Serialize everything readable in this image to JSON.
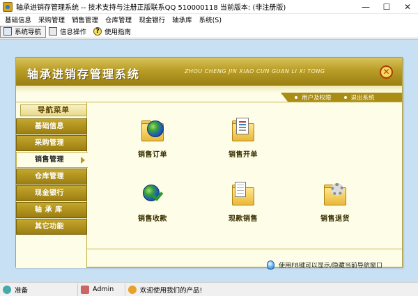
{
  "window": {
    "title": "轴承进销存管理系统 -- 技术支持与注册正版联系QQ 510000118    当前版本: (非注册版)",
    "minimize_symbol": "—",
    "maximize_symbol": "☐",
    "close_symbol": "✕"
  },
  "menu": {
    "items": [
      "基础信息",
      "采购管理",
      "销售管理",
      "仓库管理",
      "现金银行",
      "轴承库",
      "系统(S)"
    ]
  },
  "toolbar": {
    "items": [
      {
        "label": "系统导航",
        "icon": "monitor-icon",
        "active": true
      },
      {
        "label": "信息操作",
        "icon": "window-icon",
        "active": false
      },
      {
        "label": "使用指南",
        "icon": "help-icon",
        "active": false
      }
    ],
    "help_glyph": "?"
  },
  "panel": {
    "title": "轴承进销存管理系统",
    "subtitle": "ZHOU CHENG JIN XIAO CUN GUAN LI XI TONG",
    "close_glyph": "✕",
    "user_links": [
      "用户及权限",
      "退出系统"
    ]
  },
  "nav": {
    "header": "导航菜单",
    "items": [
      "基础信息",
      "采购管理",
      "销售管理",
      "仓库管理",
      "现金银行",
      "轴 承 库",
      "其它功能"
    ],
    "active_index": 2
  },
  "content": {
    "tiles": [
      {
        "label": "销售订单",
        "icon": "folder-globe-icon"
      },
      {
        "label": "销售开单",
        "icon": "folder-document-icon"
      },
      {
        "label": "销售收款",
        "icon": "globe-check-icon"
      },
      {
        "label": "现款销售",
        "icon": "folder-calendar-icon"
      },
      {
        "label": "销售退货",
        "icon": "folder-gear-icon"
      }
    ],
    "hint": "使用F8键可以显示/隐藏当前导航窗口"
  },
  "status": {
    "ready": "准备",
    "user": "Admin",
    "welcome": "欢迎使用我们的产品!"
  },
  "colors": {
    "header_gold": "#b99d27",
    "panel_bg": "#fdfde8",
    "client_bg": "#c8e0f4",
    "nav_gold": "#9b7e12"
  }
}
